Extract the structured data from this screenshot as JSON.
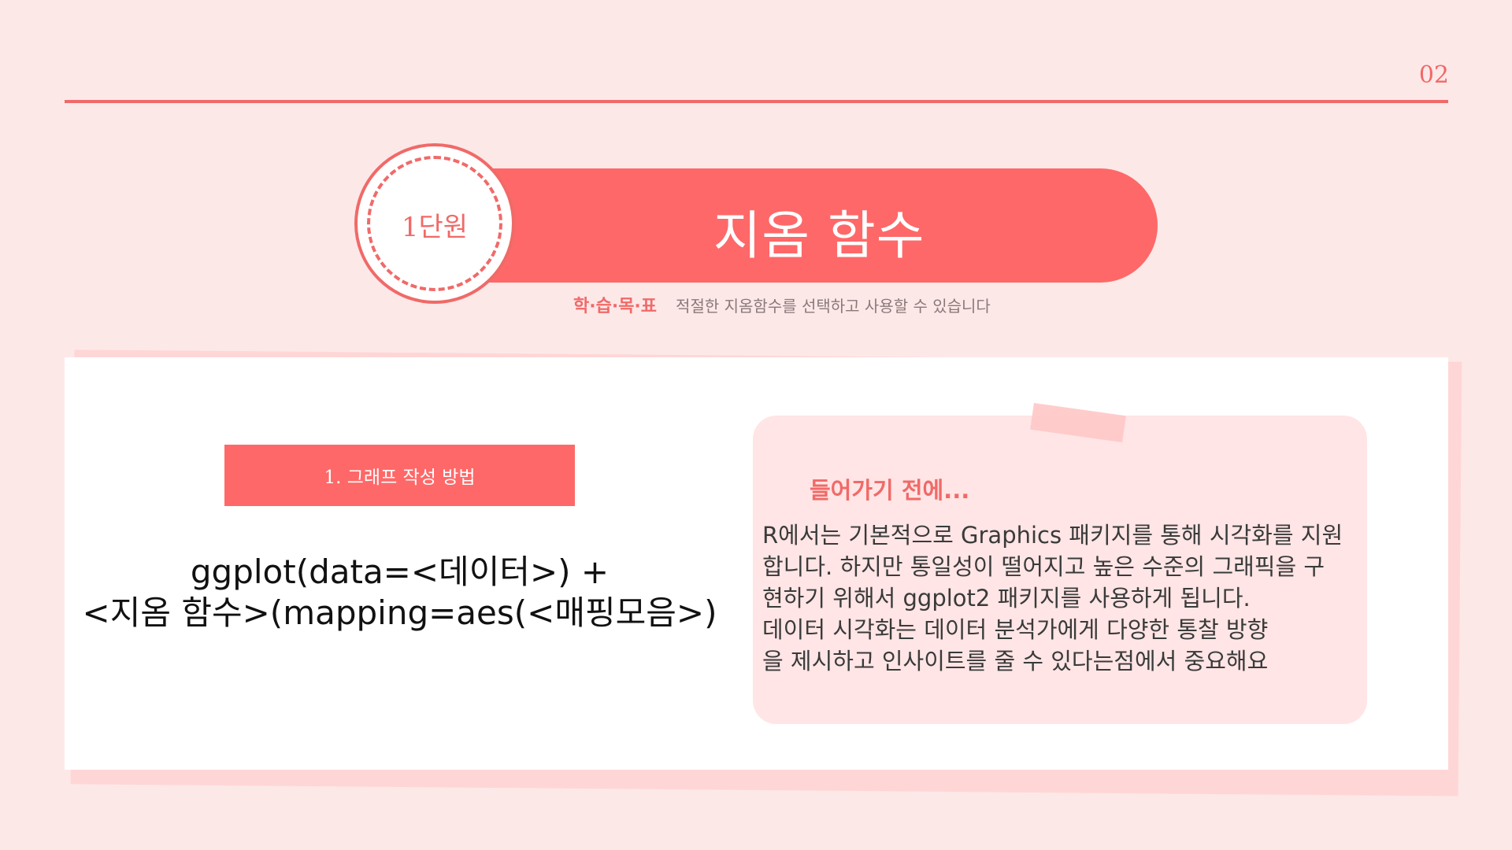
{
  "page_number": "02",
  "unit": {
    "label": "1단원"
  },
  "title": "지옴 함수",
  "objective": {
    "label": "학·습·목·표",
    "text": "적절한 지옴함수를 선택하고 사용할 수 있습니다"
  },
  "section": {
    "header": "1. 그래프 작성 방법"
  },
  "code": {
    "line1": "ggplot(data=<데이터>) +",
    "line2": "<지옴 함수>(mapping=aes(<매핑모음>)"
  },
  "note": {
    "title": "들어가기 전에...",
    "lines": [
      "R에서는 기본적으로 Graphics 패키지를 통해 시각화를 지원",
      "합니다. 하지만 통일성이 떨어지고 높은 수준의 그래픽을 구",
      "현하기 위해서 ggplot2 패키지를 사용하게 됩니다.",
      "데이터 시각화는 데이터 분석가에게 다양한 통찰 방향",
      "을 제시하고 인사이트를 줄 수 있다는점에서 중요해요"
    ]
  },
  "colors": {
    "background": "#fde8e8",
    "accent": "#ff6868",
    "accent_dark": "#f06a68",
    "note_bg": "#ffe5e5"
  }
}
